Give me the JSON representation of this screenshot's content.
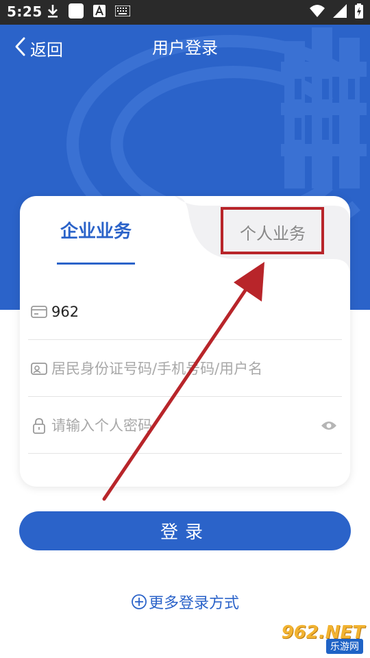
{
  "status_bar": {
    "time": "5:25",
    "left_icons": [
      "download-icon",
      "square-icon",
      "a-icon",
      "keyboard-icon"
    ],
    "right_icons": [
      "wifi-icon",
      "signal-icon",
      "battery-icon"
    ]
  },
  "nav": {
    "back_label": "返回",
    "title": "用户登录"
  },
  "tabs": {
    "enterprise": "企业业务",
    "personal": "个人业务",
    "active": "enterprise"
  },
  "form": {
    "tax_code_value": "962",
    "account_placeholder": "居民身份证号码/手机号码/用户名",
    "password_placeholder": "请输入个人密码"
  },
  "login_button_label": "登录",
  "more_login_label": "更多登录方式",
  "watermark": {
    "main": "962.NET",
    "sub": "乐游网"
  },
  "colors": {
    "primary": "#2b63c9",
    "annotation": "#b8252a",
    "status_bar": "#2a2a2a"
  }
}
